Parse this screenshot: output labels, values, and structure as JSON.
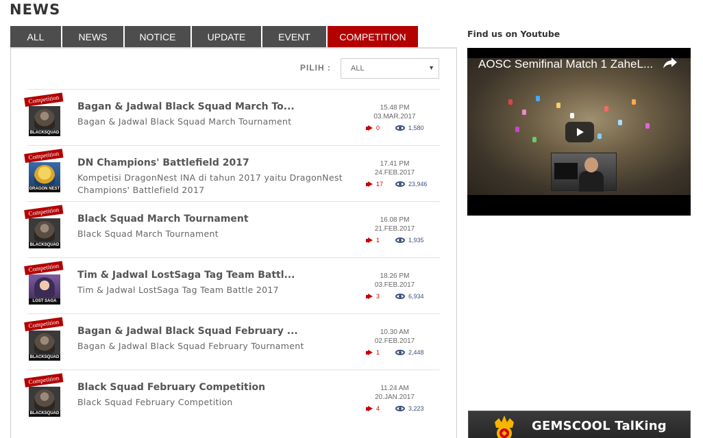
{
  "page_title": "NEWS",
  "tabs": [
    {
      "label": "ALL",
      "active": false
    },
    {
      "label": "NEWS",
      "active": false
    },
    {
      "label": "NOTICE",
      "active": false
    },
    {
      "label": "UPDATE",
      "active": false
    },
    {
      "label": "EVENT",
      "active": false
    },
    {
      "label": "COMPETITION",
      "active": true
    }
  ],
  "filter": {
    "label": "PILIH :",
    "selected": "ALL"
  },
  "news": [
    {
      "badge": "Competition",
      "game": "BLACKSQUAD",
      "title": "Bagan & Jadwal Black Squad March To...",
      "desc": "Bagan & Jadwal Black Squad March Tournament",
      "time": "15.48 PM",
      "date": "03.MAR.2017",
      "comments": "0",
      "views": "1,580"
    },
    {
      "badge": "Competition",
      "game": "DRAGON NEST",
      "title": "DN Champions' Battlefield 2017",
      "desc": "Kompetisi DragonNest INA di tahun 2017 yaitu DragonNest Champions' Battlefield 2017",
      "time": "17.41 PM",
      "date": "24.FEB.2017",
      "comments": "17",
      "views": "23,946"
    },
    {
      "badge": "Competition",
      "game": "BLACKSQUAD",
      "title": "Black Squad March Tournament",
      "desc": "Black Squad March Tournament",
      "time": "16.08 PM",
      "date": "21.FEB.2017",
      "comments": "1",
      "views": "1,935"
    },
    {
      "badge": "Competition",
      "game": "LOST SAGA",
      "title": "Tim & Jadwal LostSaga Tag Team Battl...",
      "desc": "Tim & Jadwal LostSaga Tag Team Battle 2017",
      "time": "18.26 PM",
      "date": "03.FEB.2017",
      "comments": "3",
      "views": "6,934"
    },
    {
      "badge": "Competition",
      "game": "BLACKSQUAD",
      "title": "Bagan & Jadwal Black Squad February ...",
      "desc": "Bagan & Jadwal Black Squad February Tournament",
      "time": "10.30 AM",
      "date": "02.FEB.2017",
      "comments": "1",
      "views": "2,448"
    },
    {
      "badge": "Competition",
      "game": "BLACKSQUAD",
      "title": "Black Squad February Competition",
      "desc": "Black Squad February Competition",
      "time": "11.24 AM",
      "date": "20.JAN.2017",
      "comments": "4",
      "views": "3,223"
    }
  ],
  "sidebar": {
    "youtube_heading": "Find us on Youtube",
    "video_title": "AOSC Semifinal Match 1 ZaheL...",
    "banner_text": "GEMSCOOL TalKing"
  },
  "colors": {
    "accent": "#b30000",
    "tab_bg": "#4d4d4d",
    "views": "#3a4f7a"
  },
  "icons": {
    "comments": "megaphone-icon",
    "views": "eye-icon",
    "share": "share-icon",
    "play": "play-icon",
    "dropdown": "caret-down-icon"
  }
}
